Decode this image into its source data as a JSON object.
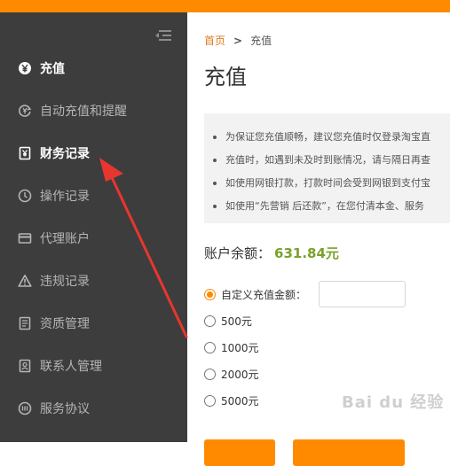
{
  "sidebar": {
    "collapse_icon": "menu-fold-icon",
    "items": [
      {
        "label": "充值",
        "icon": "yen-circle-icon",
        "active": true
      },
      {
        "label": "自动充值和提醒",
        "icon": "auto-recharge-icon",
        "active": false
      },
      {
        "label": "财务记录",
        "icon": "finance-record-icon",
        "active": true
      },
      {
        "label": "操作记录",
        "icon": "clock-icon",
        "active": false
      },
      {
        "label": "代理账户",
        "icon": "card-icon",
        "active": false
      },
      {
        "label": "违规记录",
        "icon": "warning-icon",
        "active": false
      },
      {
        "label": "资质管理",
        "icon": "document-icon",
        "active": false
      },
      {
        "label": "联系人管理",
        "icon": "contact-icon",
        "active": false
      },
      {
        "label": "服务协议",
        "icon": "agreement-icon",
        "active": false
      }
    ]
  },
  "breadcrumb": {
    "home": "首页",
    "separator": ">",
    "current": "充值"
  },
  "page": {
    "title": "充值"
  },
  "notice": {
    "lines": [
      "为保证您充值顺畅，建议您充值时仅登录淘宝直",
      "充值时，如遇到未及时到账情况，请与隔日再查",
      "如使用网银打款，打款时间会受到网银到支付宝",
      "如使用“先营销 后还款”，在您付清本金、服务"
    ]
  },
  "balance": {
    "label": "账户余额：",
    "value": "631.84元"
  },
  "amount_options": [
    {
      "label": "自定义充值金额：",
      "checked": true
    },
    {
      "label": "500元",
      "checked": false
    },
    {
      "label": "1000元",
      "checked": false
    },
    {
      "label": "2000元",
      "checked": false
    },
    {
      "label": "5000元",
      "checked": false
    }
  ],
  "custom_amount_input": {
    "value": ""
  },
  "watermark": "Bai du 经验",
  "colors": {
    "accent": "#ff8a00",
    "sidebar_bg": "#3d3d3d",
    "balance_value": "#7aa12a",
    "annotation_arrow": "#e8362f"
  }
}
